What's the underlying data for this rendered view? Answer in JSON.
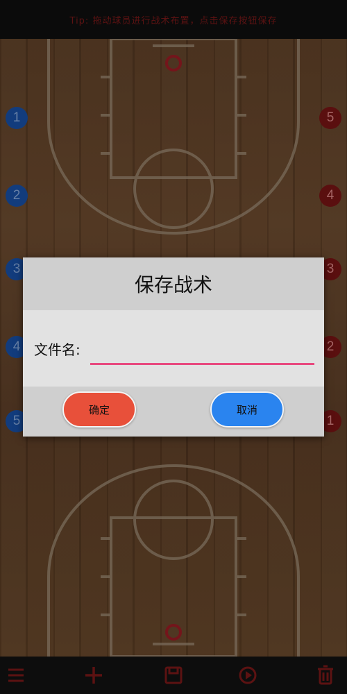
{
  "topbar": {
    "hint": "Tip: 拖动球员进行战术布置，点击保存按钮保存"
  },
  "court": {
    "blue_players": [
      "1",
      "2",
      "3",
      "4",
      "5"
    ],
    "red_players": [
      "5",
      "4",
      "3",
      "2",
      "1"
    ]
  },
  "dialog": {
    "title": "保存战术",
    "field_label": "文件名:",
    "field_value": "",
    "confirm_label": "确定",
    "cancel_label": "取消"
  },
  "toolbar": {
    "icons": [
      "menu-icon",
      "add-icon",
      "save-icon",
      "play-icon",
      "trash-icon"
    ]
  },
  "colors": {
    "confirm": "#e8503a",
    "cancel": "#2a84ef",
    "input_underline": "#e84a7f",
    "team_blue": "#1d5dc0",
    "team_red": "#8a1717",
    "toolbar_icon": "#8e1d1d"
  }
}
